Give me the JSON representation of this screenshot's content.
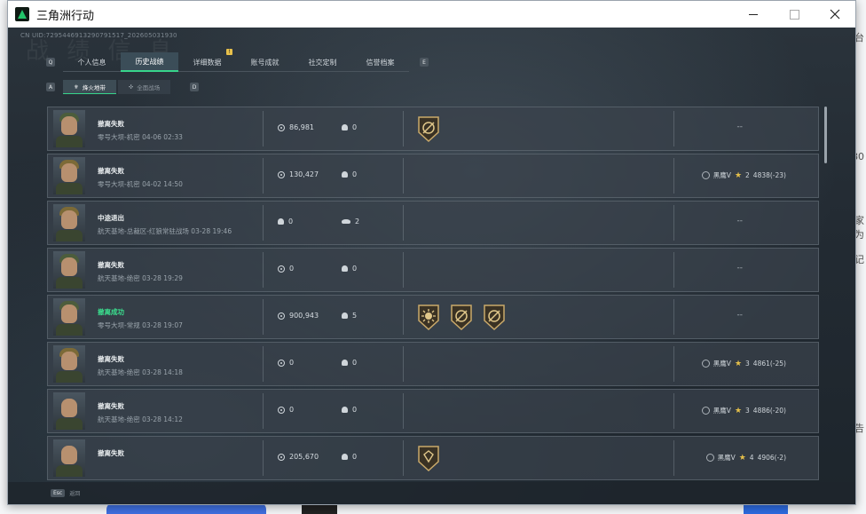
{
  "window": {
    "title": "三角洲行动"
  },
  "header": {
    "uid": "CN UID:7295446913290791517_202605031930",
    "watermark": "战 绩 信 息"
  },
  "tabs": [
    {
      "label": "个人信息",
      "active": false
    },
    {
      "label": "历史战绩",
      "active": true
    },
    {
      "label": "详细数据",
      "active": false,
      "badge": "!"
    },
    {
      "label": "账号成就",
      "active": false
    },
    {
      "label": "社交定制",
      "active": false
    },
    {
      "label": "信誉档案",
      "active": false
    }
  ],
  "key_hints": {
    "tab_prev": "Q",
    "tab_next": "E",
    "sub_prev": "A",
    "sub_next": "D"
  },
  "subtabs": [
    {
      "label": "烽火地带",
      "active": true
    },
    {
      "label": "全面战场",
      "active": false
    }
  ],
  "records": [
    {
      "result": "撤离失败",
      "success": false,
      "map": "零号大坝-机密 04-06 02:33",
      "value": "86,981",
      "kills": "0",
      "stat_type": "kills",
      "badges": [
        "gear-badge"
      ],
      "rank": null,
      "empty": "--",
      "avatar": "olive"
    },
    {
      "result": "撤离失败",
      "success": false,
      "map": "零号大坝-机密 04-02 14:50",
      "value": "130,427",
      "kills": "0",
      "stat_type": "kills",
      "badges": [],
      "rank": {
        "tier": "黑鹰V",
        "stars": "2",
        "score": "4838(-23)"
      },
      "avatar": "gold"
    },
    {
      "result": "中途退出",
      "success": false,
      "map": "航天基地-总裁区-红狼常驻战场 03-28 19:46",
      "value": "0",
      "kills": "2",
      "stat_type": "skull-wing",
      "badges": [],
      "rank": null,
      "empty": "--",
      "avatar": "gold"
    },
    {
      "result": "撤离失败",
      "success": false,
      "map": "航天基地-绝密 03-28 19:29",
      "value": "0",
      "kills": "0",
      "stat_type": "kills",
      "badges": [],
      "rank": null,
      "empty": "--",
      "avatar": "olive"
    },
    {
      "result": "撤离成功",
      "success": true,
      "map": "零号大坝-常规 03-28 19:07",
      "value": "900,943",
      "kills": "5",
      "stat_type": "kills",
      "badges": [
        "sun-badge",
        "gear-badge",
        "gear-badge"
      ],
      "rank": null,
      "empty": "--",
      "avatar": "olive"
    },
    {
      "result": "撤离失败",
      "success": false,
      "map": "航天基地-绝密 03-28 14:18",
      "value": "0",
      "kills": "0",
      "stat_type": "kills",
      "badges": [],
      "rank": {
        "tier": "黑鹰V",
        "stars": "3",
        "score": "4861(-25)"
      },
      "avatar": "gold"
    },
    {
      "result": "撤离失败",
      "success": false,
      "map": "航天基地-绝密 03-28 14:12",
      "value": "0",
      "kills": "0",
      "stat_type": "kills",
      "badges": [],
      "rank": {
        "tier": "黑鹰V",
        "stars": "3",
        "score": "4886(-20)"
      },
      "avatar": "bare"
    },
    {
      "result": "撤离失败",
      "success": false,
      "map": "",
      "value": "205,670",
      "kills": "0",
      "stat_type": "kills",
      "badges": [
        "crest-badge"
      ],
      "rank": {
        "tier": "黑鹰V",
        "stars": "4",
        "score": "4906(-2)"
      },
      "avatar": "bare"
    }
  ],
  "footer": {
    "esc_key": "Esc",
    "esc_label": "返回"
  },
  "colors": {
    "accent": "#37d48b",
    "success": "#3be08f",
    "gold": "#e6c04a"
  }
}
